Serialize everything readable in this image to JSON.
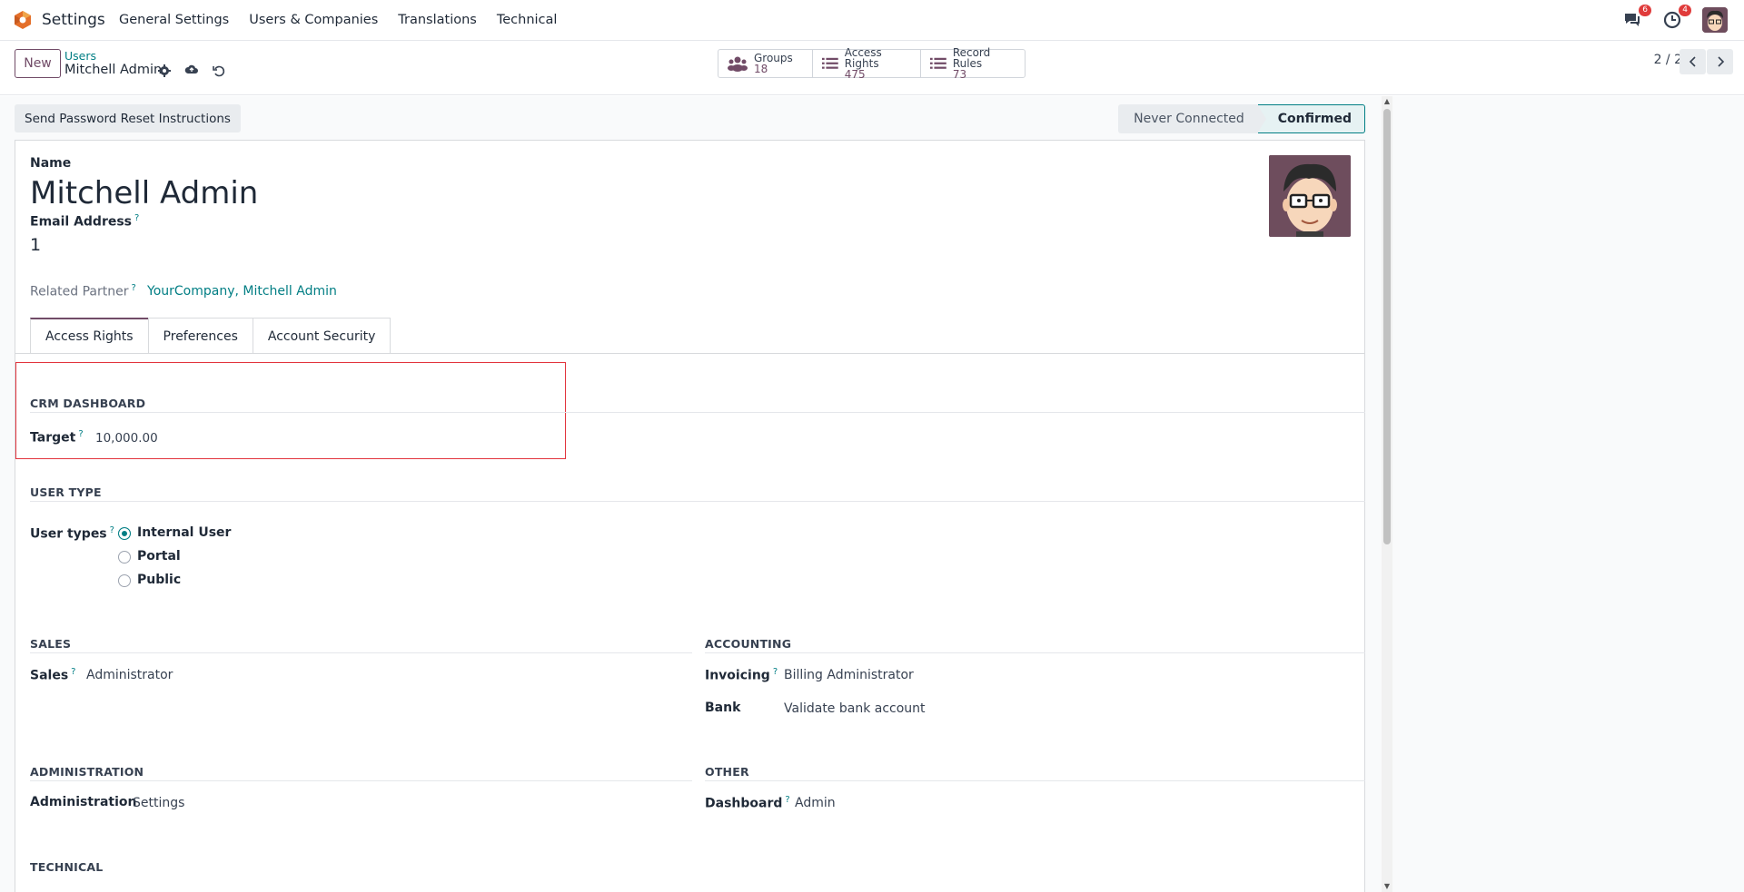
{
  "app": {
    "name": "Settings",
    "menu": [
      "General Settings",
      "Users & Companies",
      "Translations",
      "Technical"
    ],
    "messages_badge": "6",
    "activities_badge": "4"
  },
  "control": {
    "new_label": "New",
    "breadcrumb_parent": "Users",
    "breadcrumb_current": "Mitchell Admin",
    "smart_buttons": [
      {
        "label": "Groups",
        "value": "18",
        "icon": "users-icon"
      },
      {
        "label": "Access Rights",
        "value": "475",
        "icon": "list-icon"
      },
      {
        "label": "Record Rules",
        "value": "73",
        "icon": "list-icon"
      }
    ],
    "pager": "2 / 2"
  },
  "statusbar": {
    "reset_button": "Send Password Reset Instructions",
    "stages": [
      "Never Connected",
      "Confirmed"
    ],
    "active_stage": "Confirmed"
  },
  "form": {
    "name_label": "Name",
    "name_value": "Mitchell Admin",
    "email_label": "Email Address",
    "email_value": "1",
    "partner_label": "Related Partner",
    "partner_value": "YourCompany, Mitchell Admin",
    "tabs": [
      "Access Rights",
      "Preferences",
      "Account Security"
    ],
    "crm": {
      "title": "CRM DASHBOARD",
      "target_label": "Target",
      "target_value": "10,000.00"
    },
    "user_type": {
      "title": "USER TYPE",
      "label": "User types",
      "options": [
        "Internal User",
        "Portal",
        "Public"
      ],
      "selected": "Internal User"
    },
    "sales": {
      "title": "SALES",
      "label": "Sales",
      "value": "Administrator"
    },
    "accounting": {
      "title": "ACCOUNTING",
      "invoicing_label": "Invoicing",
      "invoicing_value": "Billing Administrator",
      "bank_label": "Bank",
      "bank_value": "Validate bank account"
    },
    "administration": {
      "title": "ADMINISTRATION",
      "label": "Administration",
      "value": "Settings"
    },
    "other": {
      "title": "OTHER",
      "label": "Dashboard",
      "value": "Admin"
    },
    "technical_title": "TECHNICAL"
  },
  "colors": {
    "brand": "#714b67",
    "accent": "#017e84",
    "highlight": "#e2343d"
  }
}
